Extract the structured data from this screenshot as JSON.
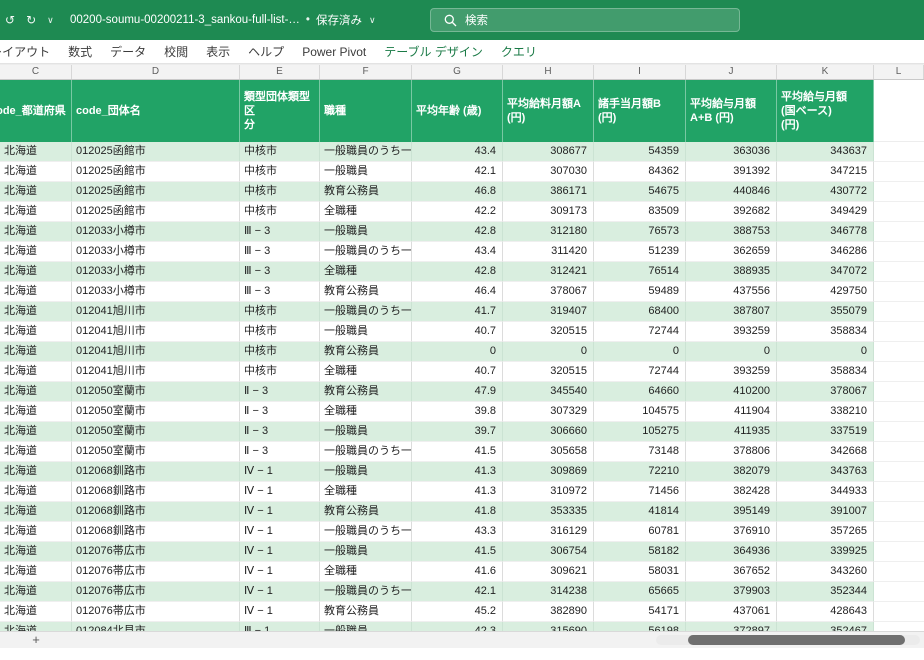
{
  "title_bar": {
    "icons": {
      "undo": "↺",
      "redo": "↻",
      "caret": "∨"
    },
    "file_name": "00200-soumu-00200211-3_sankou-full-list-…",
    "saved_dot": "•",
    "save_status": "保存済み",
    "save_caret": "∨",
    "search": {
      "placeholder": "検索"
    }
  },
  "ribbon": {
    "tabs": [
      {
        "label": "ページ レイアウト",
        "contextual": false
      },
      {
        "label": "数式",
        "contextual": false
      },
      {
        "label": "データ",
        "contextual": false
      },
      {
        "label": "校閲",
        "contextual": false
      },
      {
        "label": "表示",
        "contextual": false
      },
      {
        "label": "ヘルプ",
        "contextual": false
      },
      {
        "label": "Power Pivot",
        "contextual": false
      },
      {
        "label": "テーブル デザイン",
        "contextual": true
      },
      {
        "label": "クエリ",
        "contextual": true
      }
    ]
  },
  "sheet": {
    "column_letters": [
      "C",
      "D",
      "E",
      "F",
      "G",
      "H",
      "I",
      "J",
      "K",
      "L"
    ],
    "headers": [
      "code_都道府県",
      "code_団体名",
      "類型団体類型区\n分",
      "職種",
      "平均年齢 (歳)",
      "平均給料月額A\n(円)",
      "諸手当月額B\n(円)",
      "平均給与月額\nA+B (円)",
      "平均給与月額\n(国ベース)\n(円)"
    ],
    "rows": [
      [
        "北海道",
        "012025函館市",
        "中核市",
        "一般職員のうち一般行政職",
        "43.4",
        "308677",
        "54359",
        "363036",
        "343637"
      ],
      [
        "北海道",
        "012025函館市",
        "中核市",
        "一般職員",
        "42.1",
        "307030",
        "84362",
        "391392",
        "347215"
      ],
      [
        "北海道",
        "012025函館市",
        "中核市",
        "教育公務員",
        "46.8",
        "386171",
        "54675",
        "440846",
        "430772"
      ],
      [
        "北海道",
        "012025函館市",
        "中核市",
        "全職種",
        "42.2",
        "309173",
        "83509",
        "392682",
        "349429"
      ],
      [
        "北海道",
        "012033小樽市",
        "Ⅲ − 3",
        "一般職員",
        "42.8",
        "312180",
        "76573",
        "388753",
        "346778"
      ],
      [
        "北海道",
        "012033小樽市",
        "Ⅲ − 3",
        "一般職員のうち一般行政職",
        "43.4",
        "311420",
        "51239",
        "362659",
        "346286"
      ],
      [
        "北海道",
        "012033小樽市",
        "Ⅲ − 3",
        "全職種",
        "42.8",
        "312421",
        "76514",
        "388935",
        "347072"
      ],
      [
        "北海道",
        "012033小樽市",
        "Ⅲ − 3",
        "教育公務員",
        "46.4",
        "378067",
        "59489",
        "437556",
        "429750"
      ],
      [
        "北海道",
        "012041旭川市",
        "中核市",
        "一般職員のうち一般行政職",
        "41.7",
        "319407",
        "68400",
        "387807",
        "355079"
      ],
      [
        "北海道",
        "012041旭川市",
        "中核市",
        "一般職員",
        "40.7",
        "320515",
        "72744",
        "393259",
        "358834"
      ],
      [
        "北海道",
        "012041旭川市",
        "中核市",
        "教育公務員",
        "0",
        "0",
        "0",
        "0",
        "0"
      ],
      [
        "北海道",
        "012041旭川市",
        "中核市",
        "全職種",
        "40.7",
        "320515",
        "72744",
        "393259",
        "358834"
      ],
      [
        "北海道",
        "012050室蘭市",
        "Ⅱ − 3",
        "教育公務員",
        "47.9",
        "345540",
        "64660",
        "410200",
        "378067"
      ],
      [
        "北海道",
        "012050室蘭市",
        "Ⅱ − 3",
        "全職種",
        "39.8",
        "307329",
        "104575",
        "411904",
        "338210"
      ],
      [
        "北海道",
        "012050室蘭市",
        "Ⅱ − 3",
        "一般職員",
        "39.7",
        "306660",
        "105275",
        "411935",
        "337519"
      ],
      [
        "北海道",
        "012050室蘭市",
        "Ⅱ − 3",
        "一般職員のうち一般行政職",
        "41.5",
        "305658",
        "73148",
        "378806",
        "342668"
      ],
      [
        "北海道",
        "012068釧路市",
        "Ⅳ − 1",
        "一般職員",
        "41.3",
        "309869",
        "72210",
        "382079",
        "343763"
      ],
      [
        "北海道",
        "012068釧路市",
        "Ⅳ − 1",
        "全職種",
        "41.3",
        "310972",
        "71456",
        "382428",
        "344933"
      ],
      [
        "北海道",
        "012068釧路市",
        "Ⅳ − 1",
        "教育公務員",
        "41.8",
        "353335",
        "41814",
        "395149",
        "391007"
      ],
      [
        "北海道",
        "012068釧路市",
        "Ⅳ − 1",
        "一般職員のうち一般行政職",
        "43.3",
        "316129",
        "60781",
        "376910",
        "357265"
      ],
      [
        "北海道",
        "012076帯広市",
        "Ⅳ − 1",
        "一般職員",
        "41.5",
        "306754",
        "58182",
        "364936",
        "339925"
      ],
      [
        "北海道",
        "012076帯広市",
        "Ⅳ − 1",
        "全職種",
        "41.6",
        "309621",
        "58031",
        "367652",
        "343260"
      ],
      [
        "北海道",
        "012076帯広市",
        "Ⅳ − 1",
        "一般職員のうち一般行政職",
        "42.1",
        "314238",
        "65665",
        "379903",
        "352344"
      ],
      [
        "北海道",
        "012076帯広市",
        "Ⅳ − 1",
        "教育公務員",
        "45.2",
        "382890",
        "54171",
        "437061",
        "428643"
      ],
      [
        "北海道",
        "012084北見市",
        "Ⅲ − 1",
        "一般職員",
        "42.3",
        "315690",
        "56198",
        "372897",
        "352467"
      ]
    ]
  },
  "bottom_bar": {
    "new_sheet_label": "+"
  },
  "colors": {
    "titlebar_green": "#1E8A52",
    "header_green": "#21A366",
    "band_green": "#D9EEDF",
    "contextual_tab_green": "#1A7A46",
    "scrollbar_thumb": "#6F6F6F"
  }
}
